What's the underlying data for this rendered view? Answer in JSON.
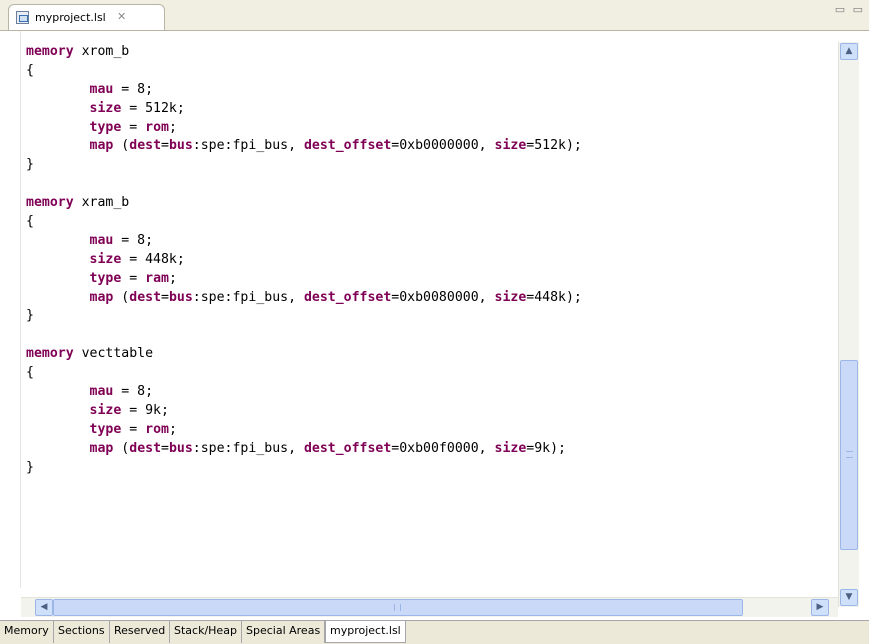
{
  "editor_tab": {
    "title": "myproject.lsl",
    "close_glyph": "✕"
  },
  "view_controls": "▭ ▭",
  "code_lines": [
    [
      [
        "kw",
        "memory"
      ],
      [
        "t",
        " xrom_b"
      ]
    ],
    [
      [
        "t",
        "{"
      ]
    ],
    [
      [
        "t",
        "        "
      ],
      [
        "kw",
        "mau"
      ],
      [
        "t",
        " = 8;"
      ]
    ],
    [
      [
        "t",
        "        "
      ],
      [
        "kw",
        "size"
      ],
      [
        "t",
        " = 512k;"
      ]
    ],
    [
      [
        "t",
        "        "
      ],
      [
        "kw",
        "type"
      ],
      [
        "t",
        " = "
      ],
      [
        "kw",
        "rom"
      ],
      [
        "t",
        ";"
      ]
    ],
    [
      [
        "t",
        "        "
      ],
      [
        "kw",
        "map"
      ],
      [
        "t",
        " ("
      ],
      [
        "kw",
        "dest"
      ],
      [
        "t",
        "="
      ],
      [
        "kw",
        "bus"
      ],
      [
        "t",
        ":spe:fpi_bus, "
      ],
      [
        "kw",
        "dest_offset"
      ],
      [
        "t",
        "=0xb0000000, "
      ],
      [
        "kw",
        "size"
      ],
      [
        "t",
        "=512k);"
      ]
    ],
    [
      [
        "t",
        "}"
      ]
    ],
    [
      [
        "t",
        ""
      ]
    ],
    [
      [
        "kw",
        "memory"
      ],
      [
        "t",
        " xram_b"
      ]
    ],
    [
      [
        "t",
        "{"
      ]
    ],
    [
      [
        "t",
        "        "
      ],
      [
        "kw",
        "mau"
      ],
      [
        "t",
        " = 8;"
      ]
    ],
    [
      [
        "t",
        "        "
      ],
      [
        "kw",
        "size"
      ],
      [
        "t",
        " = 448k;"
      ]
    ],
    [
      [
        "t",
        "        "
      ],
      [
        "kw",
        "type"
      ],
      [
        "t",
        " = "
      ],
      [
        "kw",
        "ram"
      ],
      [
        "t",
        ";"
      ]
    ],
    [
      [
        "t",
        "        "
      ],
      [
        "kw",
        "map"
      ],
      [
        "t",
        " ("
      ],
      [
        "kw",
        "dest"
      ],
      [
        "t",
        "="
      ],
      [
        "kw",
        "bus"
      ],
      [
        "t",
        ":spe:fpi_bus, "
      ],
      [
        "kw",
        "dest_offset"
      ],
      [
        "t",
        "=0xb0080000, "
      ],
      [
        "kw",
        "size"
      ],
      [
        "t",
        "=448k);"
      ]
    ],
    [
      [
        "t",
        "}"
      ]
    ],
    [
      [
        "t",
        ""
      ]
    ],
    [
      [
        "kw",
        "memory"
      ],
      [
        "t",
        " vecttable"
      ]
    ],
    [
      [
        "t",
        "{"
      ]
    ],
    [
      [
        "t",
        "        "
      ],
      [
        "kw",
        "mau"
      ],
      [
        "t",
        " = 8;"
      ]
    ],
    [
      [
        "t",
        "        "
      ],
      [
        "kw",
        "size"
      ],
      [
        "t",
        " = 9k;"
      ]
    ],
    [
      [
        "t",
        "        "
      ],
      [
        "kw",
        "type"
      ],
      [
        "t",
        " = "
      ],
      [
        "kw",
        "rom"
      ],
      [
        "t",
        ";"
      ]
    ],
    [
      [
        "t",
        "        "
      ],
      [
        "kw",
        "map"
      ],
      [
        "t",
        " ("
      ],
      [
        "kw",
        "dest"
      ],
      [
        "t",
        "="
      ],
      [
        "kw",
        "bus"
      ],
      [
        "t",
        ":spe:fpi_bus, "
      ],
      [
        "kw",
        "dest_offset"
      ],
      [
        "t",
        "=0xb00f0000, "
      ],
      [
        "kw",
        "size"
      ],
      [
        "t",
        "=9k);"
      ]
    ],
    [
      [
        "t",
        "}"
      ]
    ]
  ],
  "scrollbars": {
    "up_arrow": "▲",
    "down_arrow": "▼",
    "left_arrow": "◀",
    "right_arrow": "▶"
  },
  "bottom_tabs": [
    {
      "label": "Memory",
      "active": false
    },
    {
      "label": "Sections",
      "active": false
    },
    {
      "label": "Reserved",
      "active": false
    },
    {
      "label": "Stack/Heap",
      "active": false
    },
    {
      "label": "Special Areas",
      "active": false
    },
    {
      "label": "myproject.lsl",
      "active": true
    }
  ]
}
